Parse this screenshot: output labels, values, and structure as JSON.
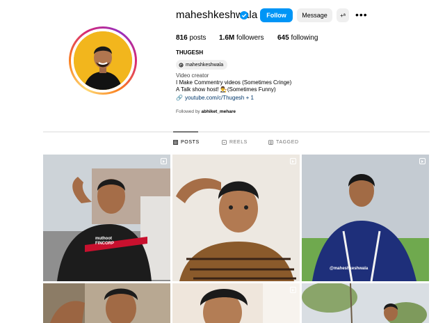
{
  "profile": {
    "username": "maheshkeshwala",
    "full_name": "THUGESH",
    "threads_handle": "maheshkeshwala",
    "bio": {
      "category": "Video creator",
      "line1": "I Make Commentry videos (Sometimes Cringe)",
      "line2": "A Talk show host! 👨‍⚖️(Sometimes Funny)",
      "link": "youtube.com/c/Thugesh + 1"
    },
    "followed_by_prefix": "Followed by ",
    "followed_by_name": "abhiket_mehare"
  },
  "actions": {
    "follow": "Follow",
    "message": "Message",
    "add_user": "+ª"
  },
  "stats": {
    "posts_value": "816",
    "posts_label": " posts",
    "followers_value": "1.6M",
    "followers_label": " followers",
    "following_value": "645",
    "following_label": " following"
  },
  "tabs": [
    {
      "label": "POSTS",
      "active": true
    },
    {
      "label": "REELS",
      "active": false
    },
    {
      "label": "TAGGED",
      "active": false
    }
  ],
  "posts": {
    "watermark": "@maheshkeshwala",
    "shirt_text": "muthoot FINCORP"
  },
  "colors": {
    "follow_blue": "#0095f6",
    "link_blue": "#00376b",
    "avatar_bg": "#f2b61d",
    "verified_blue": "#0095f6"
  }
}
